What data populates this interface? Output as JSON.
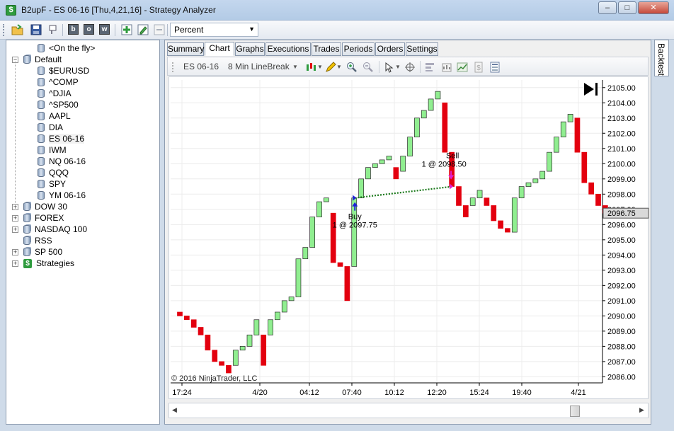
{
  "window": {
    "title": "B2upF - ES 06-16 [Thu,4,21,16] - Strategy Analyzer",
    "minimize": "–",
    "maximize": "□",
    "close": "✕"
  },
  "toolbar": {
    "letters": [
      "b",
      "o",
      "w"
    ],
    "combo_value": "Percent"
  },
  "tree": {
    "items": [
      {
        "label": "<On the fly>",
        "icon": "db-icon",
        "level": 1,
        "expander": ""
      },
      {
        "label": "Default",
        "icon": "db-stack-icon",
        "level": 0,
        "expander": "−"
      },
      {
        "label": "$EURUSD",
        "icon": "db-icon",
        "level": 1,
        "expander": ""
      },
      {
        "label": "^COMP",
        "icon": "db-icon",
        "level": 1,
        "expander": ""
      },
      {
        "label": "^DJIA",
        "icon": "db-icon",
        "level": 1,
        "expander": ""
      },
      {
        "label": "^SP500",
        "icon": "db-icon",
        "level": 1,
        "expander": ""
      },
      {
        "label": "AAPL",
        "icon": "db-icon",
        "level": 1,
        "expander": ""
      },
      {
        "label": "DIA",
        "icon": "db-icon",
        "level": 1,
        "expander": ""
      },
      {
        "label": "ES 06-16",
        "icon": "db-icon",
        "level": 1,
        "expander": "",
        "selected": true
      },
      {
        "label": "IWM",
        "icon": "db-icon",
        "level": 1,
        "expander": ""
      },
      {
        "label": "NQ 06-16",
        "icon": "db-icon",
        "level": 1,
        "expander": ""
      },
      {
        "label": "QQQ",
        "icon": "db-icon",
        "level": 1,
        "expander": ""
      },
      {
        "label": "SPY",
        "icon": "db-icon",
        "level": 1,
        "expander": ""
      },
      {
        "label": "YM 06-16",
        "icon": "db-icon",
        "level": 1,
        "expander": ""
      },
      {
        "label": "DOW 30",
        "icon": "db-stack-icon",
        "level": 0,
        "expander": "+"
      },
      {
        "label": "FOREX",
        "icon": "db-stack-icon",
        "level": 0,
        "expander": "+"
      },
      {
        "label": "NASDAQ 100",
        "icon": "db-stack-icon",
        "level": 0,
        "expander": "+"
      },
      {
        "label": "RSS",
        "icon": "db-stack-icon",
        "level": 0,
        "expander": ""
      },
      {
        "label": "SP 500",
        "icon": "db-stack-icon",
        "level": 0,
        "expander": "+"
      },
      {
        "label": "Strategies",
        "icon": "dollar-icon",
        "level": 0,
        "expander": "+"
      }
    ]
  },
  "tabs": [
    {
      "label": "Summary"
    },
    {
      "label": "Chart",
      "active": true
    },
    {
      "label": "Graphs"
    },
    {
      "label": "Executions"
    },
    {
      "label": "Trades"
    },
    {
      "label": "Periods"
    },
    {
      "label": "Orders"
    },
    {
      "label": "Settings"
    }
  ],
  "chart_toolbar": {
    "instrument": "ES 06-16",
    "bar_type": "8 Min LineBreak"
  },
  "side_tab": {
    "label": "Backtest"
  },
  "chart_data": {
    "type": "candlestick",
    "instrument": "ES 06-16",
    "bar_type": "8 Min LineBreak",
    "y_ticks": [
      "2105.00",
      "2104.00",
      "2103.00",
      "2102.00",
      "2101.00",
      "2100.00",
      "2099.00",
      "2098.00",
      "2097.00",
      "2096.00",
      "2095.00",
      "2094.00",
      "2093.00",
      "2092.00",
      "2091.00",
      "2090.00",
      "2089.00",
      "2088.00",
      "2087.00",
      "2086.00"
    ],
    "ylim": [
      2085.6,
      2105.5
    ],
    "x_ticks": [
      "17:24",
      "4/20",
      "04:12",
      "07:40",
      "10:12",
      "12:20",
      "15:24",
      "19:40",
      "4/21"
    ],
    "current_price": "2096.75",
    "copyright": "© 2016 NinjaTrader, LLC",
    "bars": [
      {
        "dir": "down",
        "open": 2090.25,
        "close": 2090.0
      },
      {
        "dir": "down",
        "open": 2090.0,
        "close": 2089.75
      },
      {
        "dir": "down",
        "open": 2089.75,
        "close": 2089.25
      },
      {
        "dir": "down",
        "open": 2089.25,
        "close": 2088.75
      },
      {
        "dir": "down",
        "open": 2088.75,
        "close": 2087.75
      },
      {
        "dir": "down",
        "open": 2087.75,
        "close": 2087.0
      },
      {
        "dir": "down",
        "open": 2087.0,
        "close": 2086.75
      },
      {
        "dir": "down",
        "open": 2086.75,
        "close": 2086.25
      },
      {
        "dir": "up",
        "open": 2086.75,
        "close": 2087.75
      },
      {
        "dir": "up",
        "open": 2087.75,
        "close": 2088.0
      },
      {
        "dir": "up",
        "open": 2088.0,
        "close": 2088.75
      },
      {
        "dir": "up",
        "open": 2088.75,
        "close": 2089.75
      },
      {
        "dir": "down",
        "open": 2088.75,
        "close": 2086.75
      },
      {
        "dir": "up",
        "open": 2088.75,
        "close": 2089.75
      },
      {
        "dir": "up",
        "open": 2089.75,
        "close": 2090.25
      },
      {
        "dir": "up",
        "open": 2090.25,
        "close": 2091.0
      },
      {
        "dir": "up",
        "open": 2091.0,
        "close": 2091.25
      },
      {
        "dir": "up",
        "open": 2091.25,
        "close": 2093.75
      },
      {
        "dir": "up",
        "open": 2093.75,
        "close": 2094.5
      },
      {
        "dir": "up",
        "open": 2094.5,
        "close": 2096.5
      },
      {
        "dir": "up",
        "open": 2096.5,
        "close": 2097.5
      },
      {
        "dir": "up",
        "open": 2097.5,
        "close": 2097.75
      },
      {
        "dir": "down",
        "open": 2096.75,
        "close": 2093.5
      },
      {
        "dir": "down",
        "open": 2093.5,
        "close": 2093.25
      },
      {
        "dir": "down",
        "open": 2093.25,
        "close": 2091.0
      },
      {
        "dir": "up",
        "open": 2093.25,
        "close": 2097.75
      },
      {
        "dir": "up",
        "open": 2097.75,
        "close": 2099.0
      },
      {
        "dir": "up",
        "open": 2099.0,
        "close": 2099.75
      },
      {
        "dir": "up",
        "open": 2099.75,
        "close": 2100.0
      },
      {
        "dir": "up",
        "open": 2100.0,
        "close": 2100.25
      },
      {
        "dir": "up",
        "open": 2100.25,
        "close": 2100.5
      },
      {
        "dir": "down",
        "open": 2099.75,
        "close": 2099.0
      },
      {
        "dir": "up",
        "open": 2099.5,
        "close": 2100.5
      },
      {
        "dir": "up",
        "open": 2100.5,
        "close": 2101.75
      },
      {
        "dir": "up",
        "open": 2101.75,
        "close": 2103.0
      },
      {
        "dir": "up",
        "open": 2103.0,
        "close": 2103.5
      },
      {
        "dir": "up",
        "open": 2103.5,
        "close": 2104.25
      },
      {
        "dir": "up",
        "open": 2104.25,
        "close": 2104.75
      },
      {
        "dir": "down",
        "open": 2104.0,
        "close": 2100.75
      },
      {
        "dir": "down",
        "open": 2100.75,
        "close": 2098.5
      },
      {
        "dir": "down",
        "open": 2098.5,
        "close": 2097.25
      },
      {
        "dir": "down",
        "open": 2097.25,
        "close": 2096.5
      },
      {
        "dir": "up",
        "open": 2097.25,
        "close": 2097.75
      },
      {
        "dir": "up",
        "open": 2097.75,
        "close": 2098.25
      },
      {
        "dir": "down",
        "open": 2097.75,
        "close": 2097.25
      },
      {
        "dir": "down",
        "open": 2097.25,
        "close": 2096.25
      },
      {
        "dir": "down",
        "open": 2096.25,
        "close": 2095.75
      },
      {
        "dir": "down",
        "open": 2095.75,
        "close": 2095.5
      },
      {
        "dir": "up",
        "open": 2095.5,
        "close": 2097.75
      },
      {
        "dir": "up",
        "open": 2097.75,
        "close": 2098.5
      },
      {
        "dir": "up",
        "open": 2098.5,
        "close": 2098.75
      },
      {
        "dir": "up",
        "open": 2098.75,
        "close": 2099.0
      },
      {
        "dir": "up",
        "open": 2099.0,
        "close": 2099.5
      },
      {
        "dir": "up",
        "open": 2099.5,
        "close": 2100.75
      },
      {
        "dir": "up",
        "open": 2100.75,
        "close": 2101.75
      },
      {
        "dir": "up",
        "open": 2101.75,
        "close": 2102.75
      },
      {
        "dir": "up",
        "open": 2102.75,
        "close": 2103.25
      },
      {
        "dir": "down",
        "open": 2103.0,
        "close": 2100.75
      },
      {
        "dir": "down",
        "open": 2100.75,
        "close": 2098.75
      },
      {
        "dir": "down",
        "open": 2098.75,
        "close": 2098.0
      },
      {
        "dir": "down",
        "open": 2098.0,
        "close": 2097.25
      },
      {
        "dir": "down",
        "open": 2097.25,
        "close": 2096.75
      }
    ],
    "trades": {
      "buy": {
        "label": "Buy",
        "detail": "1 @ 2097.75",
        "price": 2097.75,
        "bar_index": 25
      },
      "sell": {
        "label": "Sell",
        "detail": "1 @ 2098.50",
        "price": 2098.5,
        "bar_index": 39
      }
    },
    "colors": {
      "up": "#90ee90",
      "down": "#e3000f",
      "buy": "#1f1fd8",
      "sell": "#e020d0",
      "trade_line": "#1c7a1c"
    }
  }
}
